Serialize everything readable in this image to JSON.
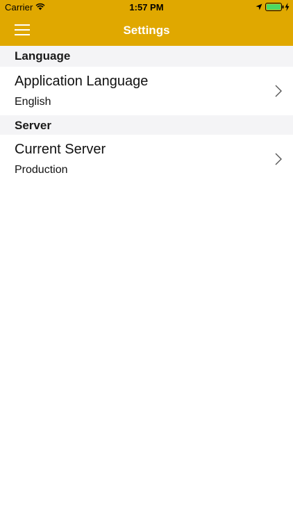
{
  "status_bar": {
    "carrier": "Carrier",
    "time": "1:57 PM",
    "icons": [
      "wifi-icon",
      "location-icon",
      "battery-icon",
      "charging-icon"
    ]
  },
  "nav": {
    "title": "Settings",
    "menu_icon": "hamburger-menu-icon"
  },
  "colors": {
    "header_background": "#e0a800",
    "section_background": "#f4f4f6",
    "battery_fill": "#4cd964"
  },
  "sections": [
    {
      "header": "Language",
      "rows": [
        {
          "title": "Application Language",
          "value": "English",
          "icon": "chevron-right-icon"
        }
      ]
    },
    {
      "header": "Server",
      "rows": [
        {
          "title": "Current Server",
          "value": "Production",
          "icon": "chevron-right-icon"
        }
      ]
    }
  ]
}
